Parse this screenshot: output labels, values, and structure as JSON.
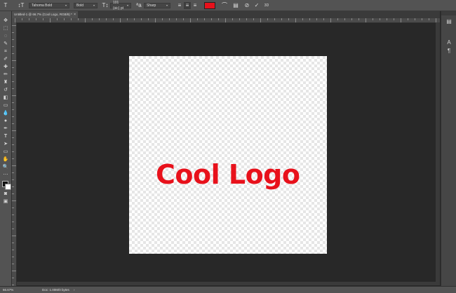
{
  "options_bar": {
    "font_family": "Tahoma Bold",
    "font_style": "Bold",
    "font_size": "101 (sic) pt",
    "antialias": "Sharp",
    "text_color": "#e8111b"
  },
  "document_tab": {
    "title": "Untitled-1 @ 66.7% (Cool Logo, RGB/8) *",
    "close": "×"
  },
  "canvas": {
    "text": "Cool Logo",
    "text_color": "#e8111b"
  },
  "status_bar": {
    "zoom": "66.67%",
    "doc": "Doc: 1.00M/0 bytes",
    "arrow": "›"
  },
  "icons": {
    "text_tool": "T",
    "orient": "↕T",
    "size": "T↕",
    "aa": "ªa",
    "align_left": "≡",
    "align_center": "≡",
    "align_right": "≡",
    "warp": "⌒",
    "panel": "▤",
    "cancel": "⊘",
    "commit": "✓",
    "threed": "3D"
  }
}
